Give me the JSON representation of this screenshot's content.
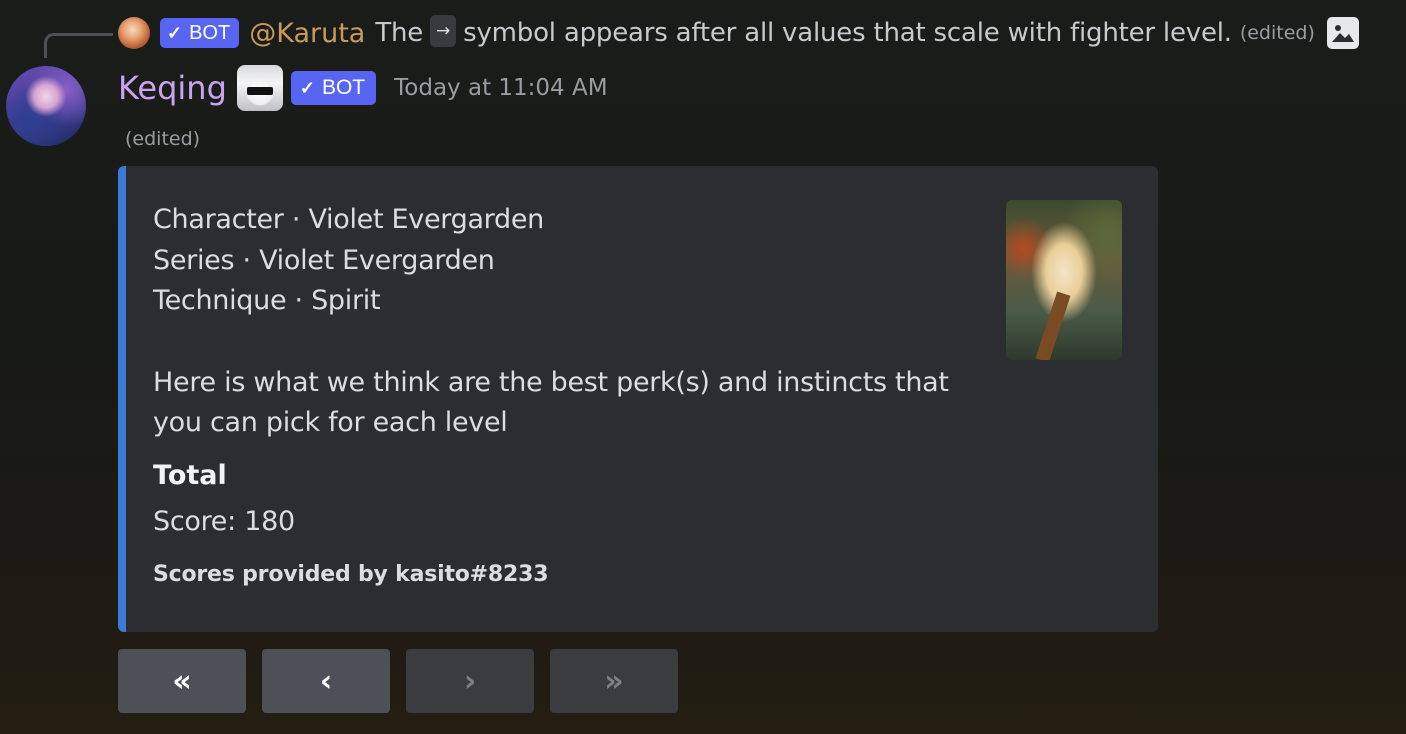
{
  "reply": {
    "author": "@Karuta",
    "bot_badge": "BOT",
    "text_before": "The",
    "kbd": "→",
    "text_after": "symbol appears after all values that scale with fighter level.",
    "edited": "(edited)",
    "icon": "image-icon"
  },
  "message": {
    "username": "Keqing",
    "bot_badge": "BOT",
    "timestamp": "Today at 11:04 AM",
    "edited": "(edited)"
  },
  "embed": {
    "accent_color": "#3b7ad6",
    "lines": [
      "Character · Violet Evergarden",
      "Series · Violet Evergarden",
      "Technique · Spirit"
    ],
    "description": [
      "Here is what we think are the best perk(s) and instincts that",
      "you can pick for each level"
    ],
    "field_name": "Total",
    "field_value": "Score: 180",
    "footer": "Scores provided by kasito#8233"
  },
  "buttons": {
    "first": "«",
    "prev": "‹",
    "next": "›",
    "last": "»"
  }
}
